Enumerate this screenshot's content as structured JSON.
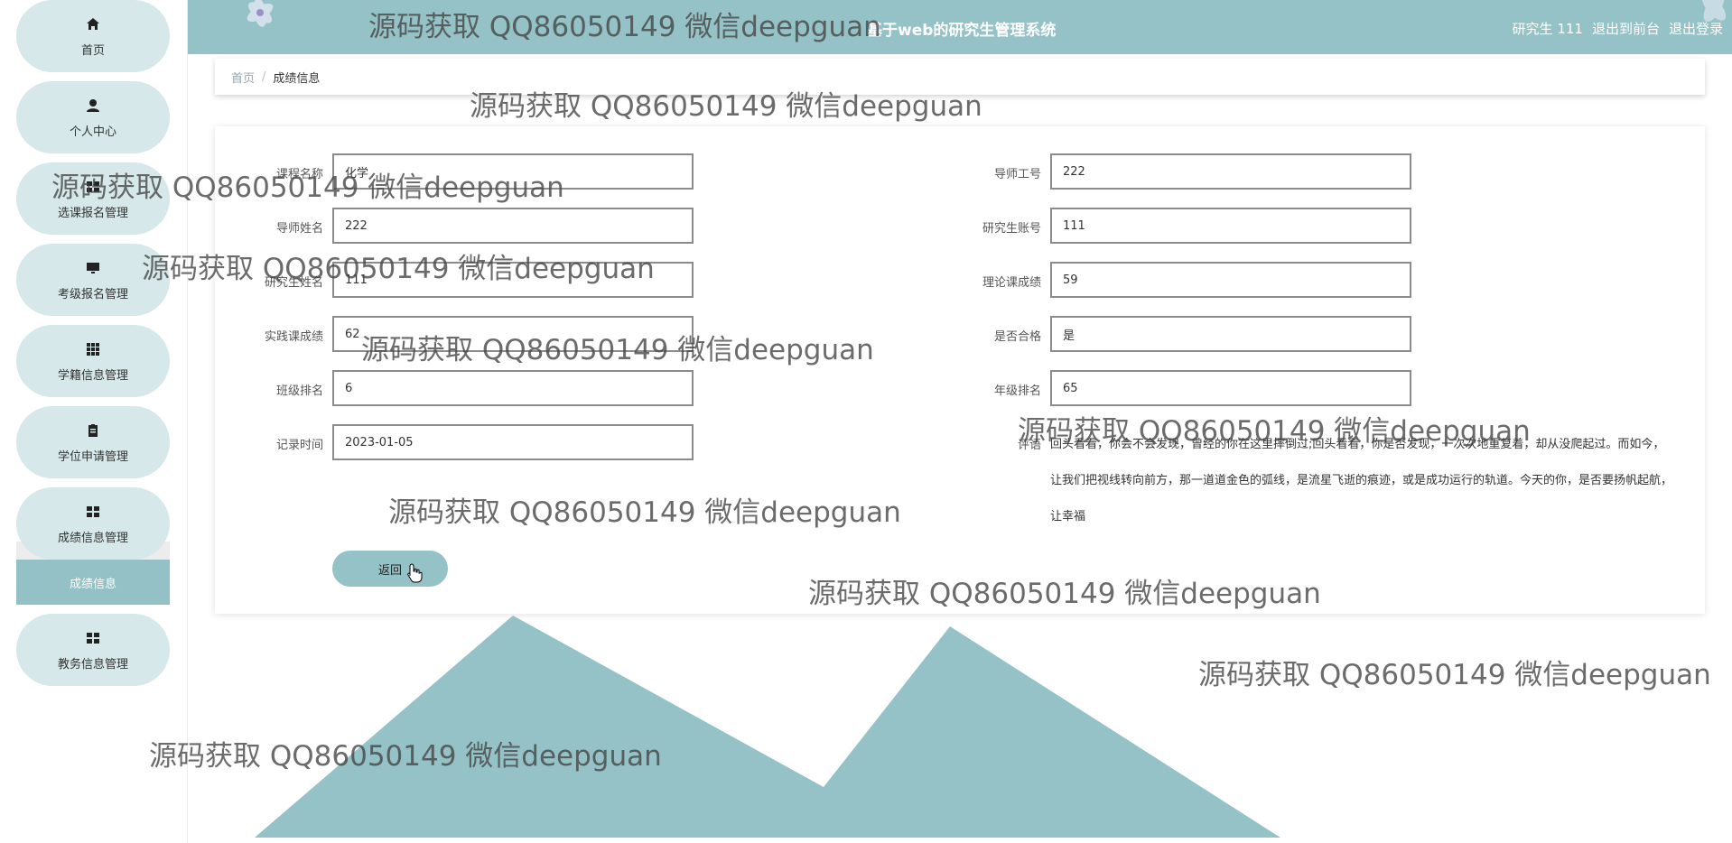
{
  "sidebar": {
    "items": [
      {
        "label": "首页",
        "icon": "home-icon"
      },
      {
        "label": "个人中心",
        "icon": "user-icon"
      },
      {
        "label": "选课报名管理",
        "icon": "grid-icon"
      },
      {
        "label": "考级报名管理",
        "icon": "monitor-icon"
      },
      {
        "label": "学籍信息管理",
        "icon": "apps-icon"
      },
      {
        "label": "学位申请管理",
        "icon": "clipboard-icon"
      },
      {
        "label": "成绩信息管理",
        "icon": "grid-icon"
      },
      {
        "label": "教务信息管理",
        "icon": "grid-icon"
      }
    ],
    "submenu": {
      "label": "成绩信息"
    }
  },
  "header": {
    "title": "基于web的研究生管理系统",
    "user_role": "研究生",
    "user_name": "111",
    "to_front": "退出到前台",
    "logout": "退出登录"
  },
  "breadcrumb": {
    "home": "首页",
    "separator": "/",
    "current": "成绩信息"
  },
  "form": {
    "course_name": {
      "label": "课程名称",
      "value": "化学"
    },
    "teacher_id": {
      "label": "导师工号",
      "value": "222"
    },
    "teacher_name": {
      "label": "导师姓名",
      "value": "222"
    },
    "student_account": {
      "label": "研究生账号",
      "value": "111"
    },
    "student_name": {
      "label": "研究生姓名",
      "value": "111"
    },
    "theory_score": {
      "label": "理论课成绩",
      "value": "59"
    },
    "practice_score": {
      "label": "实践课成绩",
      "value": "62"
    },
    "passed": {
      "label": "是否合格",
      "value": "是"
    },
    "class_rank": {
      "label": "班级排名",
      "value": "6"
    },
    "grade_rank": {
      "label": "年级排名",
      "value": "65"
    },
    "record_time": {
      "label": "记录时间",
      "value": "2023-01-05"
    },
    "comment": {
      "label": "评语",
      "value": "回头看看，你会不会发现，曾经的你在这里摔倒过;回头看看，你是否发现，一次次地重复着，却从没爬起过。而如今，让我们把视线转向前方，那一道道金色的弧线，是流星飞逝的痕迹，或是成功运行的轨道。今天的你，是否要扬帆起航，让幸福"
    },
    "back_label": "返回"
  },
  "watermark": {
    "text": "源码获取 QQ86050149 微信deepguan"
  },
  "colors": {
    "accent": "#95c2c6",
    "nav_bg": "#d6e8ea",
    "submenu_bg": "#93c1c5"
  }
}
